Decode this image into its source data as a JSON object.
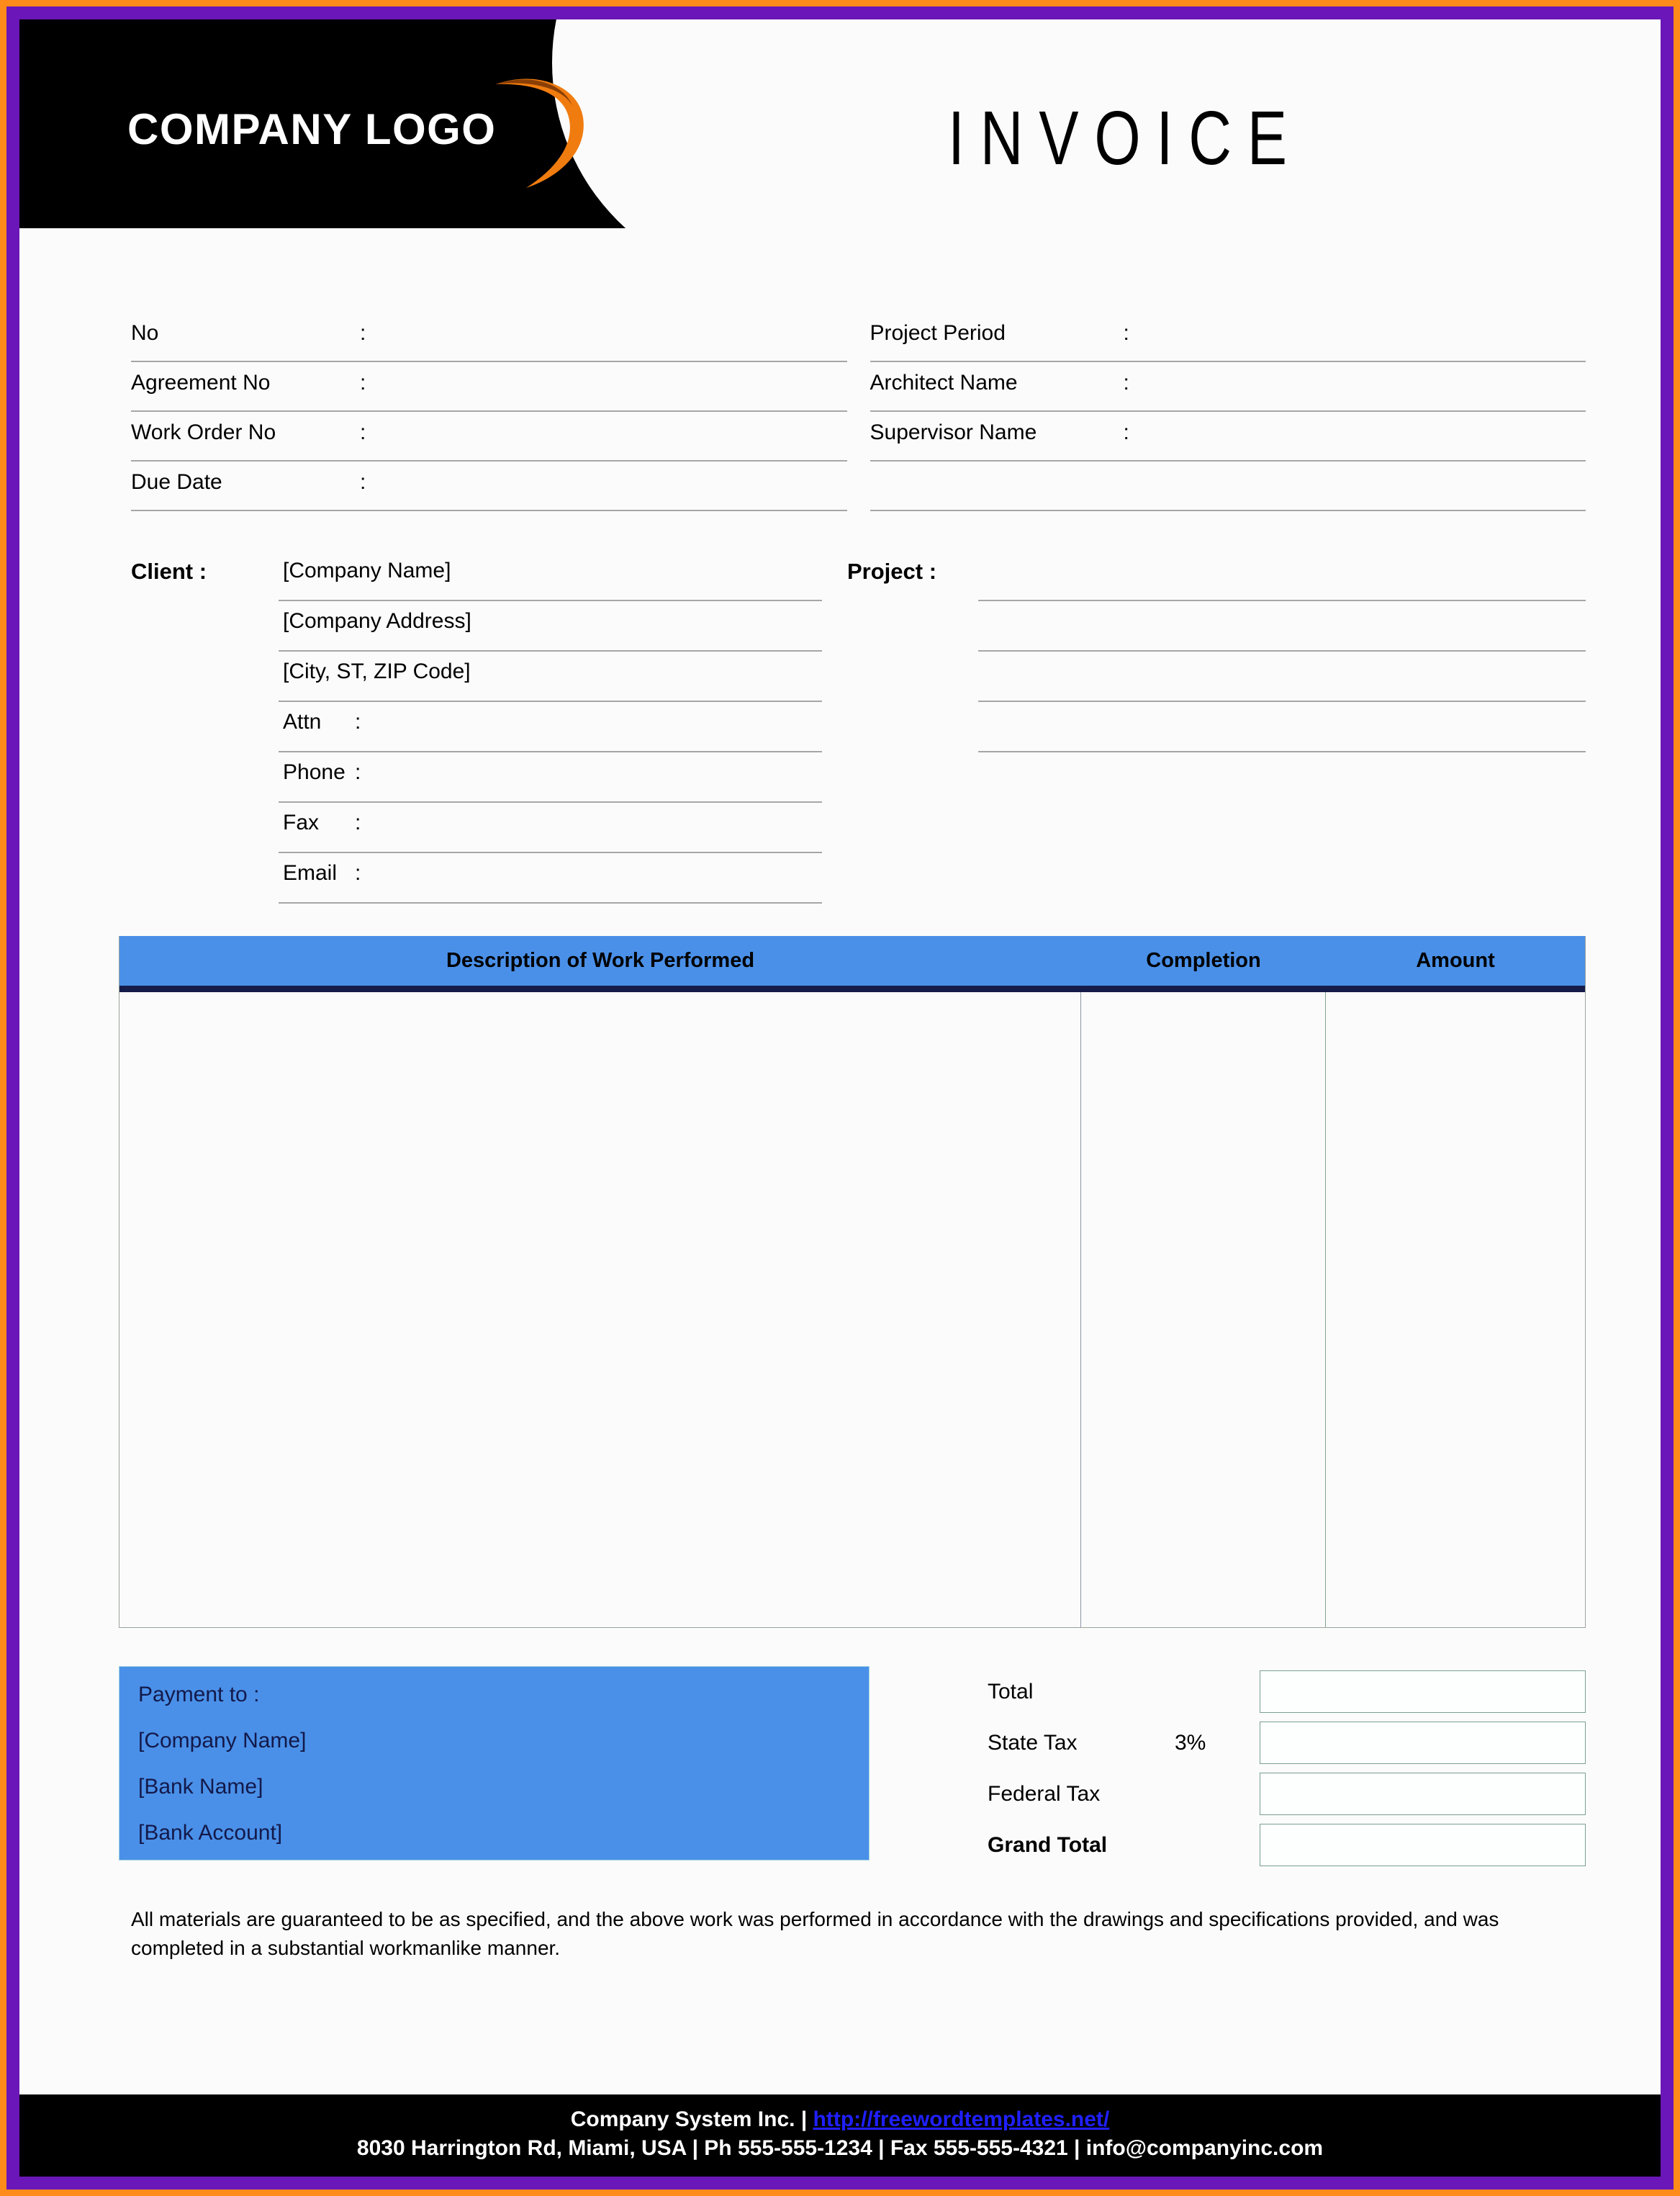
{
  "header": {
    "logo_text": "COMPANY LOGO",
    "logo_swoosh_icon": "orange-crescent-swoosh-icon",
    "title": "INVOICE",
    "accent_orange": "#ff8c1a",
    "black": "#000000"
  },
  "meta": {
    "left": [
      {
        "label": "No",
        "colon": ":",
        "value": ""
      },
      {
        "label": "Agreement No",
        "colon": ":",
        "value": ""
      },
      {
        "label": "Work Order No",
        "colon": ":",
        "value": ""
      },
      {
        "label": "Due Date",
        "colon": ":",
        "value": ""
      }
    ],
    "right": [
      {
        "label": "Project Period",
        "colon": ":",
        "value": ""
      },
      {
        "label": "Architect Name",
        "colon": ":",
        "value": ""
      },
      {
        "label": "Supervisor Name",
        "colon": ":",
        "value": ""
      },
      {
        "label": "",
        "colon": "",
        "value": ""
      }
    ]
  },
  "client": {
    "heading": "Client  :",
    "rows": [
      {
        "type": "text",
        "text": "[Company Name]"
      },
      {
        "type": "text",
        "text": "[Company Address]"
      },
      {
        "type": "text",
        "text": "[City, ST, ZIP Code]"
      },
      {
        "type": "field",
        "label": "Attn",
        "colon": ":",
        "value": ""
      },
      {
        "type": "field",
        "label": "Phone",
        "colon": ":",
        "value": ""
      },
      {
        "type": "field",
        "label": "Fax",
        "colon": ":",
        "value": ""
      },
      {
        "type": "field",
        "label": "Email",
        "colon": ":",
        "value": ""
      }
    ]
  },
  "project": {
    "heading": "Project  :",
    "rows": [
      "",
      "",
      "",
      ""
    ]
  },
  "work_table": {
    "header_bg": "#4a90e8",
    "header_rule": "#151c4a",
    "columns": [
      {
        "key": "description",
        "label": "Description of Work Performed"
      },
      {
        "key": "completion",
        "label": "Completion"
      },
      {
        "key": "amount",
        "label": "Amount"
      }
    ],
    "rows": []
  },
  "payment": {
    "bg": "#4a90e8",
    "text_color": "#13194a",
    "lines": [
      "Payment to :",
      "[Company Name]",
      "[Bank Name]",
      "[Bank Account]"
    ]
  },
  "totals": [
    {
      "label": "Total",
      "rate": "",
      "value": "",
      "bold": false
    },
    {
      "label": "State Tax",
      "rate": "3%",
      "value": "",
      "bold": false
    },
    {
      "label": "Federal Tax",
      "rate": "",
      "value": "",
      "bold": false
    },
    {
      "label": "Grand Total",
      "rate": "",
      "value": "",
      "bold": true
    }
  ],
  "guarantee": "All materials are guaranteed to be as specified, and the above work was performed in accordance with the drawings and specifications provided, and was completed in a substantial workmanlike manner.",
  "footer": {
    "company": "Company System Inc. | ",
    "url": "http://freewordtemplates.net/",
    "url_color": "#2020ff",
    "address_line": "8030 Harrington Rd, Miami, USA | Ph 555-555-1234 | Fax 555-555-4321 | info@companyinc.com"
  }
}
